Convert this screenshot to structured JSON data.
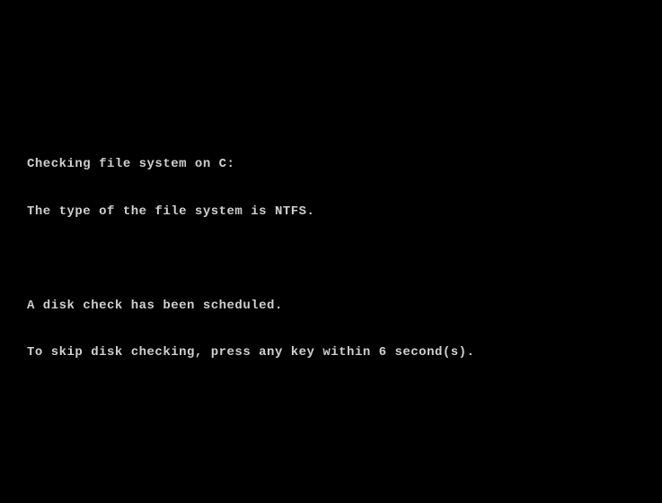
{
  "boot": {
    "line1": "Checking file system on C:",
    "line2": "The type of the file system is NTFS.",
    "line3": "A disk check has been scheduled.",
    "line4": "To skip disk checking, press any key within 6 second(s)."
  }
}
